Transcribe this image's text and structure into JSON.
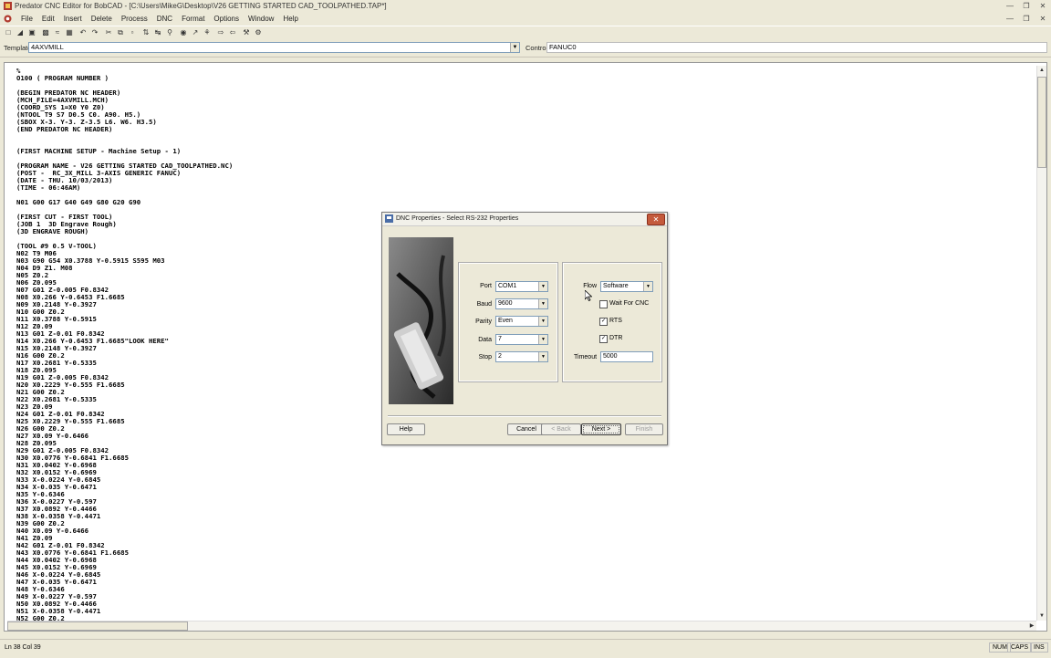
{
  "app": {
    "title": "Predator CNC Editor for BobCAD - [C:\\Users\\MikeG\\Desktop\\V26 GETTING STARTED CAD_TOOLPATHED.TAP*]"
  },
  "menu": [
    "File",
    "Edit",
    "Insert",
    "Delete",
    "Process",
    "DNC",
    "Format",
    "Options",
    "Window",
    "Help"
  ],
  "template_bar": {
    "template_label": "Template",
    "template_value": "4AXVMILL",
    "control_label": "Control",
    "control_value": "FANUC0"
  },
  "code_lines": [
    "%",
    "O100 ( PROGRAM NUMBER )",
    "",
    "(BEGIN PREDATOR NC HEADER)",
    "(MCH_FILE=4AXVMILL.MCH)",
    "(COORD_SYS 1=X0 Y0 Z0)",
    "(NTOOL T9 S7 D0.5 C0. A90. H5.)",
    "(SBOX X-3. Y-3. Z-3.5 L6. W6. H3.5)",
    "(END PREDATOR NC HEADER)",
    "",
    "",
    "(FIRST MACHINE SETUP - Machine Setup - 1)",
    "",
    "(PROGRAM NAME - V26 GETTING STARTED CAD_TOOLPATHED.NC)",
    "(POST -  RC_3X_MILL 3-AXIS GENERIC FANUC)",
    "(DATE - THU. 10/03/2013)",
    "(TIME - 06:46AM)",
    "",
    "N01 G00 G17 G40 G49 G80 G20 G90",
    "",
    "(FIRST CUT - FIRST TOOL)",
    "(JOB 1  3D Engrave Rough)",
    "(3D ENGRAVE ROUGH)",
    "",
    "(TOOL #9 0.5 V-TOOL)",
    "N02 T9 M06",
    "N03 G90 G54 X0.3788 Y-0.5915 S595 M03",
    "N04 D9 Z1. M08",
    "N05 Z0.2",
    "N06 Z0.095",
    "N07 G01 Z-0.005 F0.8342",
    "N08 X0.266 Y-0.6453 F1.6685",
    "N09 X0.2148 Y-0.3927",
    "N10 G00 Z0.2",
    "N11 X0.3788 Y-0.5915",
    "N12 Z0.09",
    "N13 G01 Z-0.01 F0.8342",
    "N14 X0.266 Y-0.6453 F1.6685\"LOOK HERE\"",
    "N15 X0.2148 Y-0.3927",
    "N16 G00 Z0.2",
    "N17 X0.2681 Y-0.5335",
    "N18 Z0.095",
    "N19 G01 Z-0.005 F0.8342",
    "N20 X0.2229 Y-0.555 F1.6685",
    "N21 G00 Z0.2",
    "N22 X0.2681 Y-0.5335",
    "N23 Z0.09",
    "N24 G01 Z-0.01 F0.8342",
    "N25 X0.2229 Y-0.555 F1.6685",
    "N26 G00 Z0.2",
    "N27 X0.09 Y-0.6466",
    "N28 Z0.095",
    "N29 G01 Z-0.005 F0.8342",
    "N30 X0.0776 Y-0.6841 F1.6685",
    "N31 X0.0402 Y-0.6968",
    "N32 X0.0152 Y-0.6969",
    "N33 X-0.0224 Y-0.6845",
    "N34 X-0.035 Y-0.6471",
    "N35 Y-0.6346",
    "N36 X-0.0227 Y-0.597",
    "N37 X0.0892 Y-0.4466",
    "N38 X-0.0358 Y-0.4471",
    "N39 G00 Z0.2",
    "N40 X0.09 Y-0.6466",
    "N41 Z0.09",
    "N42 G01 Z-0.01 F0.8342",
    "N43 X0.0776 Y-0.6841 F1.6685",
    "N44 X0.0402 Y-0.6968",
    "N45 X0.0152 Y-0.6969",
    "N46 X-0.0224 Y-0.6845",
    "N47 X-0.035 Y-0.6471",
    "N48 Y-0.6346",
    "N49 X-0.0227 Y-0.597",
    "N50 X0.0892 Y-0.4466",
    "N51 X-0.0358 Y-0.4471",
    "N52 G00 Z0.2"
  ],
  "dialog": {
    "title": "DNC Properties - Select RS-232 Properties",
    "port_label": "Port",
    "port_value": "COM1",
    "baud_label": "Baud",
    "baud_value": "9600",
    "parity_label": "Parity",
    "parity_value": "Even",
    "data_label": "Data",
    "data_value": "7",
    "stop_label": "Stop",
    "stop_value": "2",
    "flow_label": "Flow",
    "flow_value": "Software",
    "wait_label": "Wait For CNC",
    "wait_checked": false,
    "rts_label": "RTS",
    "rts_checked": true,
    "dtr_label": "DTR",
    "dtr_checked": true,
    "timeout_label": "Timeout",
    "timeout_value": "5000",
    "help_label": "Help",
    "cancel_label": "Cancel",
    "back_label": "< Back",
    "next_label": "Next >",
    "finish_label": "Finish"
  },
  "status": {
    "position": "Ln 38 Col 39",
    "num": "NUM",
    "caps": "CAPS",
    "ins": "INS"
  }
}
